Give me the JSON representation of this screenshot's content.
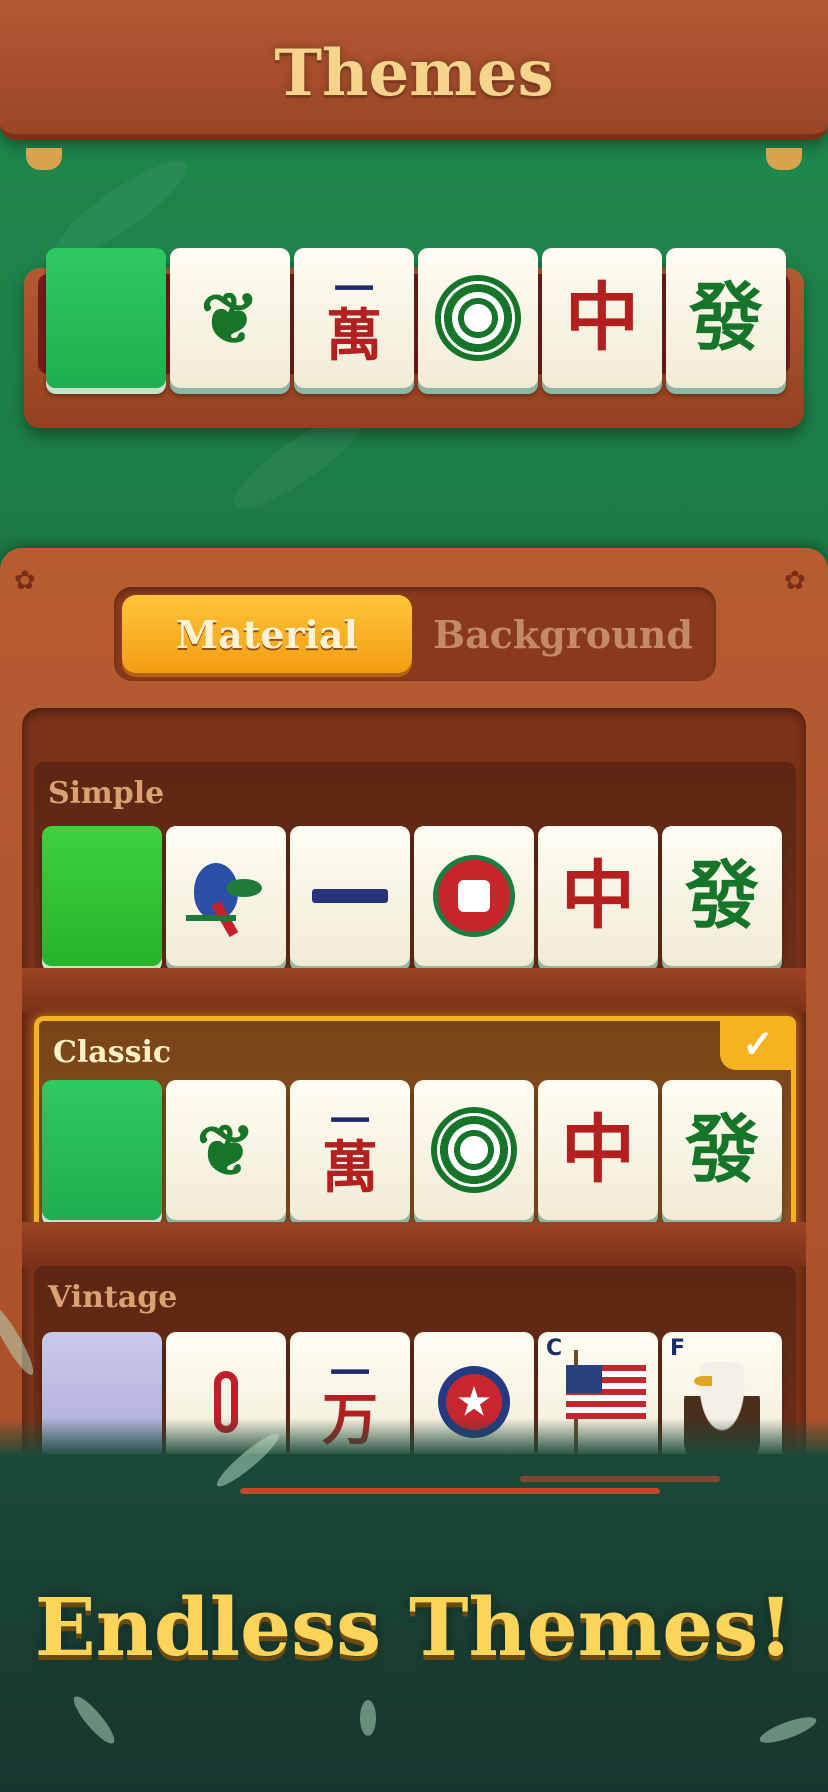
{
  "header": {
    "title": "Themes"
  },
  "tabs": {
    "material": "Material",
    "background": "Background"
  },
  "sections": {
    "simple": {
      "label": "Simple"
    },
    "classic": {
      "label": "Classic",
      "selected_mark": "✓"
    },
    "vintage": {
      "label": "Vintage"
    }
  },
  "tiles": {
    "classic_one_wan_top": "一",
    "classic_one_wan_bottom": "萬",
    "red_dragon": "中",
    "green_dragon": "發",
    "simple_red_dragon": "中",
    "simple_green_dragon": "發",
    "vintage_one_wan_top": "一",
    "vintage_one_wan_bottom": "万",
    "vintage_star": "★",
    "vintage_flag_letter": "C",
    "vintage_eagle_letter": "F"
  },
  "banner": {
    "title": "Endless Themes!"
  },
  "colors": {
    "accent": "#f5b320",
    "wood": "#b75c31",
    "felt": "#1f8a4e",
    "tile_green": "#2fc963"
  }
}
